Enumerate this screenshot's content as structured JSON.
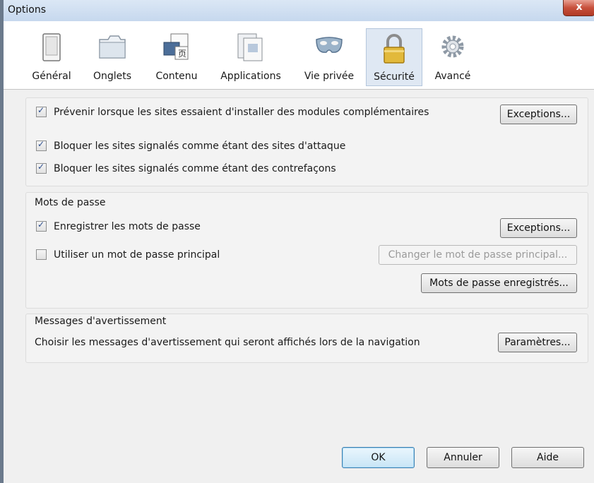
{
  "window": {
    "title": "Options",
    "close_glyph": "x"
  },
  "tabs": [
    {
      "label": "Général",
      "icon": "general-icon"
    },
    {
      "label": "Onglets",
      "icon": "tabs-folder-icon"
    },
    {
      "label": "Contenu",
      "icon": "content-icon"
    },
    {
      "label": "Applications",
      "icon": "applications-icon"
    },
    {
      "label": "Vie privée",
      "icon": "mask-icon"
    },
    {
      "label": "Sécurité",
      "icon": "padlock-icon",
      "active": true
    },
    {
      "label": "Avancé",
      "icon": "gear-icon"
    }
  ],
  "security": {
    "warn_addons": {
      "label": "Prévenir lorsque les sites essaient d'installer des modules complémentaires",
      "checked": true
    },
    "block_attack": {
      "label": "Bloquer les sites signalés comme étant des sites d'attaque",
      "checked": true
    },
    "block_forgery": {
      "label": "Bloquer les sites signalés comme étant des contrefaçons",
      "checked": true
    },
    "exceptions_label": "Exceptions..."
  },
  "passwords": {
    "title": "Mots de passe",
    "remember": {
      "label": "Enregistrer les mots de passe",
      "checked": true
    },
    "master": {
      "label": "Utiliser un mot de passe principal",
      "checked": false
    },
    "exceptions_label": "Exceptions...",
    "change_master_label": "Changer le mot de passe principal...",
    "saved_label": "Mots de passe enregistrés..."
  },
  "warnings": {
    "title": "Messages d'avertissement",
    "description": "Choisir les messages d'avertissement qui seront affichés lors de la navigation",
    "settings_label": "Paramètres..."
  },
  "footer": {
    "ok": "OK",
    "cancel": "Annuler",
    "help": "Aide"
  },
  "colors": {
    "active_tab": "#dfe8f3",
    "close": "#c7503c",
    "check": "#2a4c8c"
  }
}
